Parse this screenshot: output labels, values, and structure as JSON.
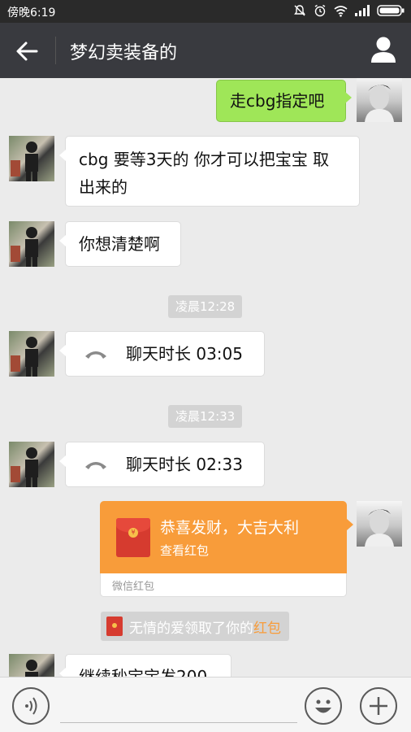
{
  "status_bar": {
    "time": "傍晚6:19"
  },
  "header": {
    "title": "梦幻卖装备的"
  },
  "messages": [
    {
      "type": "text",
      "side": "right",
      "text": "走cbg指定吧"
    },
    {
      "type": "text",
      "side": "left",
      "line1": "cbg 要等3天的 你才可以把宝宝 取",
      "line2": "出来的"
    },
    {
      "type": "text",
      "side": "left",
      "text": "你想清楚啊"
    },
    {
      "type": "time",
      "text": "凌晨12:28"
    },
    {
      "type": "call",
      "side": "left",
      "text": "聊天时长 03:05"
    },
    {
      "type": "time",
      "text": "凌晨12:33"
    },
    {
      "type": "call",
      "side": "left",
      "text": "聊天时长 02:33"
    },
    {
      "type": "redpacket",
      "side": "right",
      "greeting": "恭喜发财，大吉大利",
      "action": "查看红包",
      "footer": "微信红包"
    },
    {
      "type": "system",
      "prefix": "无情的爱领取了你的",
      "highlight": "红包"
    },
    {
      "type": "text",
      "side": "left",
      "text": "继续秒宝宝发200"
    }
  ],
  "colors": {
    "titlebar": "#393a3f",
    "self_bubble": "#9fe658",
    "redpacket": "#f89c3a",
    "background": "#ebebeb"
  },
  "icons": [
    "back-arrow-icon",
    "person-icon",
    "voice-icon",
    "emoji-icon",
    "plus-icon",
    "phone-icon"
  ]
}
